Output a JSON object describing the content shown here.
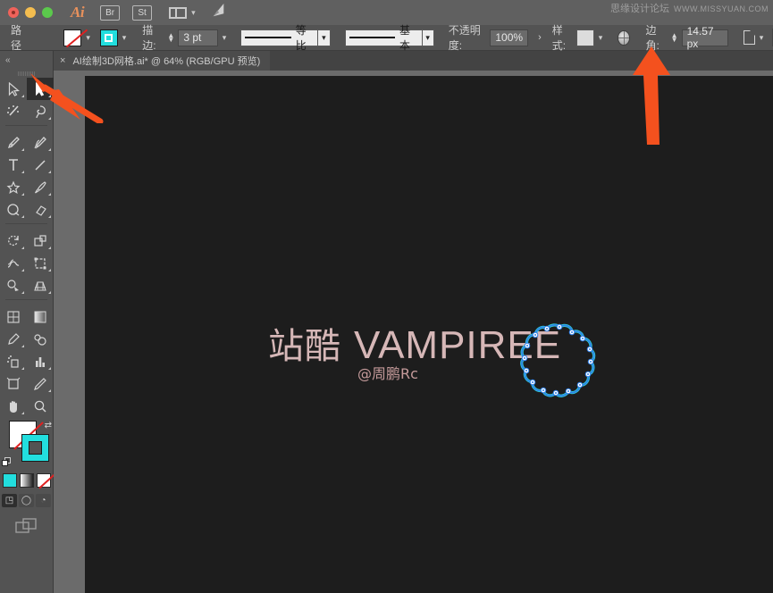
{
  "app": {
    "name": "Adobe Illustrator",
    "logo_text": "Ai",
    "window_controls": [
      "close",
      "minimize",
      "zoom"
    ],
    "chips": [
      {
        "label": "Br",
        "name": "bridge-button"
      },
      {
        "label": "St",
        "name": "stock-button"
      }
    ],
    "arrange_label": "arrange-documents",
    "search_label": "rocket-icon"
  },
  "watermark": {
    "cn": "思缘设计论坛",
    "en": "WWW.MISSYUAN.COM"
  },
  "control_bar": {
    "object_label": "路径",
    "fill": {
      "label": "fill-swatch",
      "value": "none"
    },
    "stroke_swatch": {
      "label": "stroke-swatch",
      "color": "#22DEDE"
    },
    "stroke_label": "描边:",
    "stroke_weight": "3 pt",
    "variable_width_profile": "等比",
    "brush_definition": "基本",
    "opacity_label": "不透明度:",
    "opacity_value": "100%",
    "more_arrow": "›",
    "style_label": "样式:",
    "recolor_label": "recolor-artwork-icon",
    "corner_label": "边角:",
    "corner_value": "14.57 px",
    "document_setup_label": "document-setup-icon"
  },
  "tab": {
    "close_glyph": "×",
    "title": "AI绘制3D网格.ai* @ 64% (RGB/GPU 预览)"
  },
  "toolbar": {
    "collapse_glyph": "«",
    "tools": [
      {
        "name": "direct-selection-tool",
        "active": false
      },
      {
        "name": "selection-tool",
        "active": true
      },
      {
        "name": "magic-wand-tool",
        "active": false
      },
      {
        "name": "lasso-tool",
        "active": false
      },
      {
        "name": "pen-tool",
        "active": false
      },
      {
        "name": "curvature-tool",
        "active": false
      },
      {
        "name": "type-tool",
        "active": false
      },
      {
        "name": "line-segment-tool",
        "active": false
      },
      {
        "name": "shape-tool",
        "active": false
      },
      {
        "name": "paintbrush-tool",
        "active": false
      },
      {
        "name": "shaper-tool",
        "active": false
      },
      {
        "name": "eraser-tool",
        "active": false
      },
      {
        "name": "rotate-tool",
        "active": false
      },
      {
        "name": "scale-tool",
        "active": false
      },
      {
        "name": "width-tool",
        "active": false
      },
      {
        "name": "free-transform-tool",
        "active": false
      },
      {
        "name": "shape-builder-tool",
        "active": false
      },
      {
        "name": "perspective-grid-tool",
        "active": false
      },
      {
        "name": "mesh-tool",
        "active": false
      },
      {
        "name": "gradient-tool",
        "active": false
      },
      {
        "name": "eyedropper-tool",
        "active": false
      },
      {
        "name": "blend-tool",
        "active": false
      },
      {
        "name": "symbol-sprayer-tool",
        "active": false
      },
      {
        "name": "column-graph-tool",
        "active": false
      },
      {
        "name": "artboard-tool",
        "active": false
      },
      {
        "name": "slice-tool",
        "active": false
      },
      {
        "name": "hand-tool",
        "active": false
      },
      {
        "name": "zoom-tool",
        "active": false
      }
    ],
    "fill_color": "none",
    "stroke_color": "#22DEDE",
    "color_modes": [
      "color",
      "gradient",
      "none"
    ],
    "screen_modes": [
      "normal-screen-mode",
      "full-screen-menubar",
      "full-screen"
    ]
  },
  "artwork": {
    "text_cn": "站酷",
    "text_en": "VAMPIREE",
    "subtitle": "@周鹏Rc",
    "text_color": "#D6B7B7",
    "shape_name": "scalloped-circle-path",
    "shape_stroke": "#2E7FE8",
    "shape_accent": "#2FCFD8",
    "anchor_count": 16
  },
  "annotations": {
    "arrow_color": "#F4511E",
    "arrow_1_target": "selection-tool",
    "arrow_2_target": "corner-radius-field"
  }
}
